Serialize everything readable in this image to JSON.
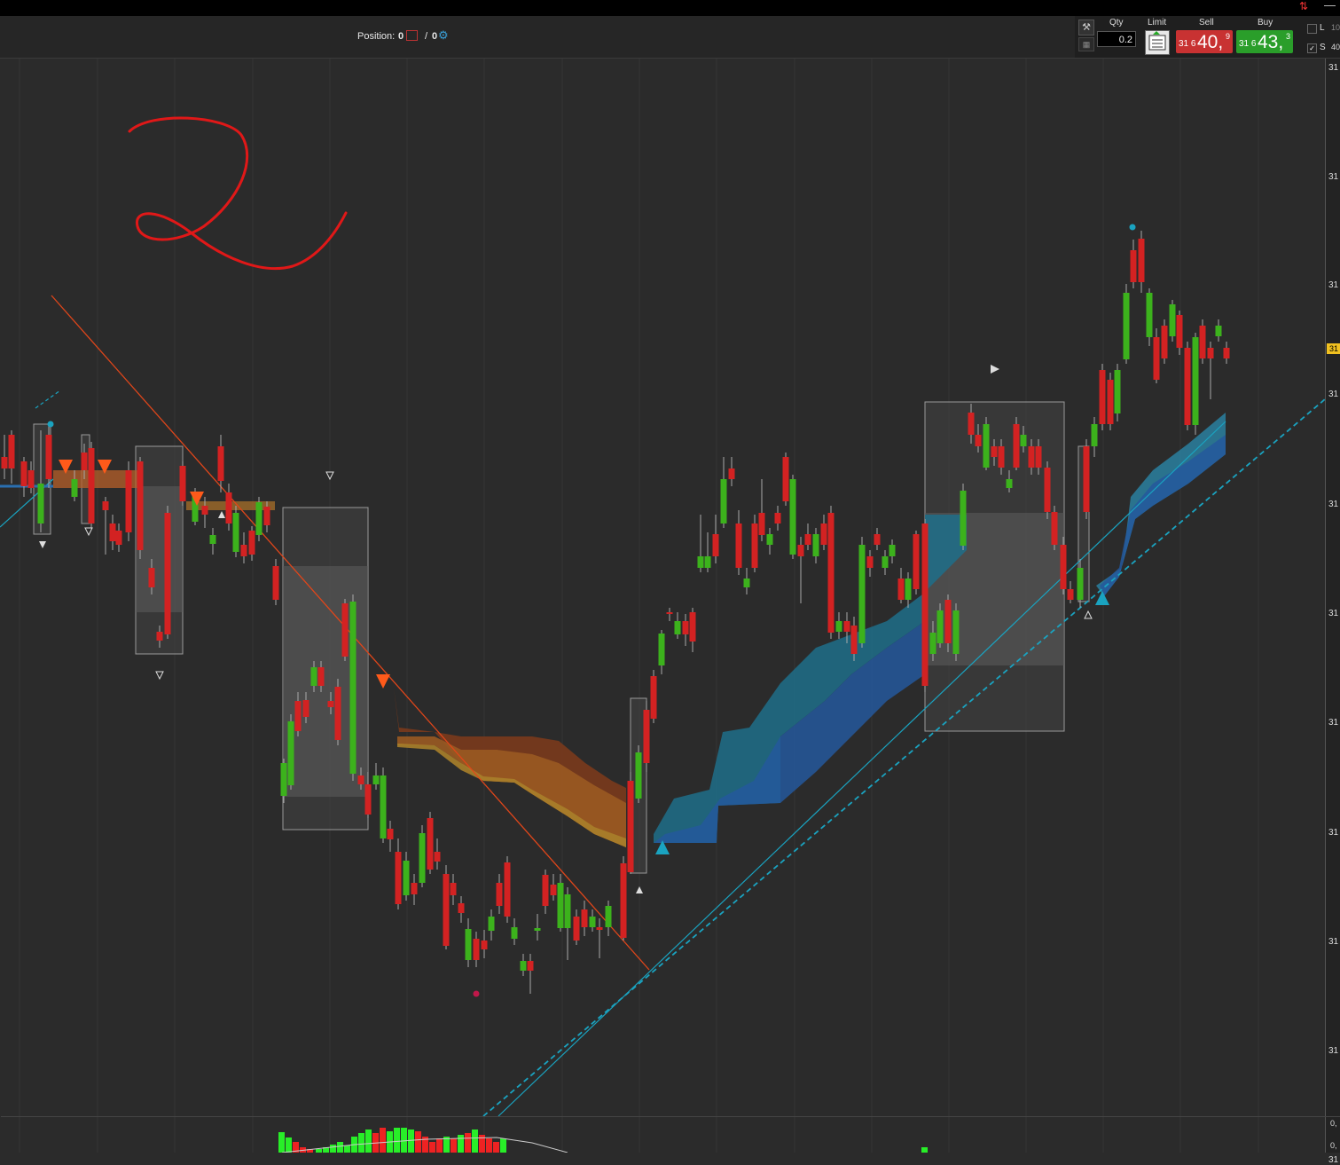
{
  "toolbar": {
    "position_label": "Position:",
    "position_value": "0",
    "position_sep": "/",
    "position_value2": "0"
  },
  "order": {
    "qty_label": "Qty",
    "qty_value": "0.2",
    "limit_label": "Limit",
    "sell_label": "Sell",
    "buy_label": "Buy",
    "sell_prefix": "31 6",
    "sell_big": "40,",
    "sell_sup": "9",
    "buy_prefix": "31 6",
    "buy_big": "43,",
    "buy_sup": "3",
    "check_l_label": "L",
    "check_s_label": "S",
    "edge_top": "10",
    "edge_bottom": "40"
  },
  "axis": {
    "labels": [
      "31",
      "31",
      "31",
      "31",
      "31",
      "31",
      "31",
      "31",
      "31",
      "31",
      "31",
      "31",
      "31",
      "31"
    ],
    "current": "31",
    "vol_top": "0,",
    "vol_bottom": "0,"
  },
  "icons": {
    "pos_icon": "close-position-icon",
    "gear": "settings-gear-icon",
    "wrench": "wrench-icon",
    "keypad": "keypad-icon",
    "limit": "limit-order-icon",
    "arrows": "up-down-arrows-icon",
    "minimize": "minimize-icon"
  },
  "colors": {
    "bull": "#3cb21c",
    "bear": "#d32222",
    "cloud_bear": "#c84a1c",
    "cloud_bull": "#2a6fb0",
    "trend": "#e0461a",
    "support": "#1aa3c0",
    "annotation": "#e01818"
  }
}
